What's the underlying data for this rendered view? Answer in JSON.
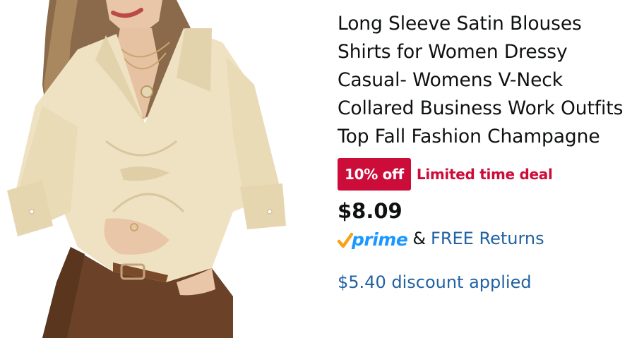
{
  "product": {
    "title": "Long Sleeve Satin Blouses Shirts for Women Dressy Casual- Womens V-Neck Collared Business Work Outfits Top Fall Fashion Champagne",
    "discount_badge": "10% off",
    "deal_label": "Limited time deal",
    "price": "$8.09",
    "prime_label": "prime",
    "ampersand": "&",
    "returns_label": "FREE Returns",
    "discount_applied": "$5.40 discount applied"
  },
  "colors": {
    "deal_red": "#cc0c39",
    "link_blue": "#2162a1",
    "prime_blue": "#1a98ff",
    "prime_check_orange": "#f7a21b",
    "text_dark": "#0f1111",
    "blouse_champagne": "#efe2c2"
  },
  "icons": {
    "prime": "prime-check-icon"
  }
}
